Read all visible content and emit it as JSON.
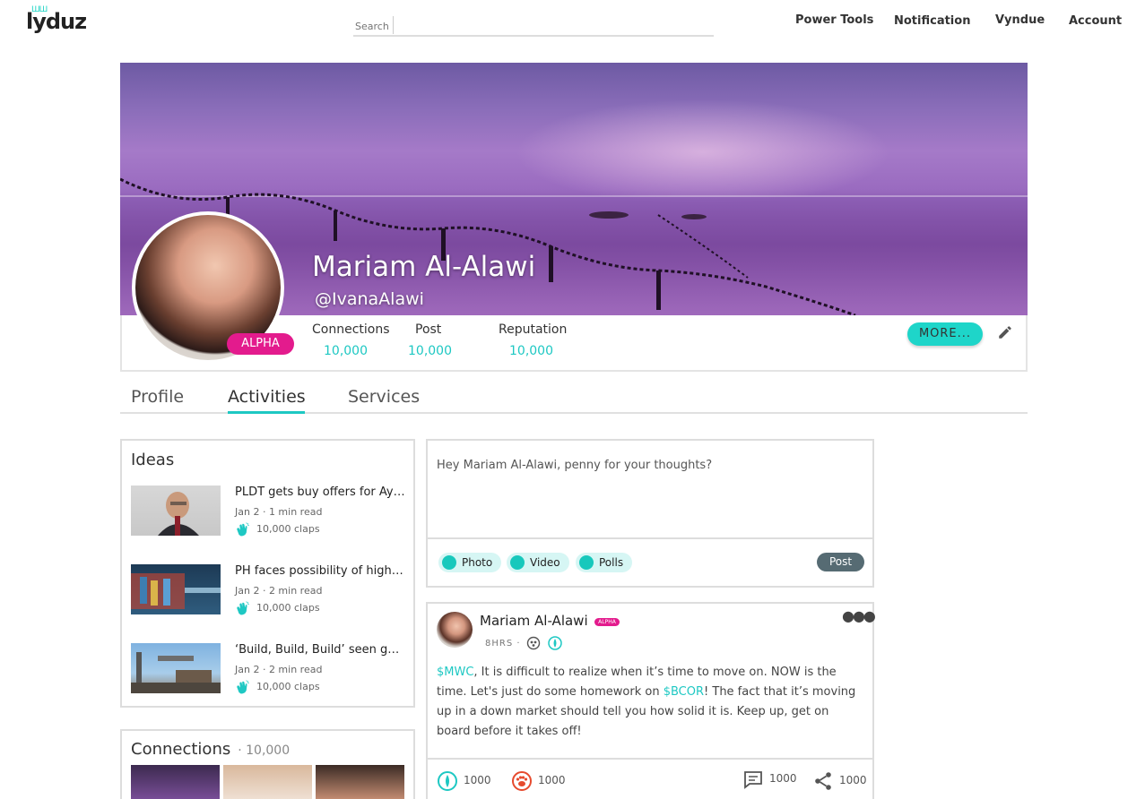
{
  "brand": {
    "logo_text": "lyduz",
    "logo_crown": "ШШ"
  },
  "search": {
    "placeholder": "Search"
  },
  "nav": {
    "items": [
      "Power Tools",
      "Notification",
      "Vyndue",
      "Account"
    ]
  },
  "profile": {
    "name": "Mariam Al-Alawi",
    "handle": "@IvanaAlawi",
    "badge": "ALPHA",
    "stats": [
      {
        "label": "Connections",
        "value": "10,000"
      },
      {
        "label": "Post",
        "value": "10,000"
      },
      {
        "label": "Reputation",
        "value": "10,000"
      }
    ],
    "more_label": "MORE..."
  },
  "tabs": [
    "Profile",
    "Activities",
    "Services"
  ],
  "active_tab": "Activities",
  "ideas": {
    "title": "Ideas",
    "items": [
      {
        "title": "PLDT gets buy offers for Ayala...",
        "meta": "Jan 2 · 1 min read",
        "claps": "10,000 claps"
      },
      {
        "title": "PH faces possibility of high inflation...",
        "meta": "Jan 2 · 2 min read",
        "claps": "10,000 claps"
      },
      {
        "title": "‘Build, Build, Build’ seen generating...",
        "meta": "Jan 2 · 2 min read",
        "claps": "10,000 claps"
      }
    ]
  },
  "composer": {
    "placeholder": "Hey Mariam Al-Alawi, penny for your thoughts?",
    "photo": "Photo",
    "video": "Video",
    "polls": "Polls",
    "post": "Post"
  },
  "post": {
    "author": "Mariam Al-Alawi",
    "badge": "ALPHA",
    "time": "8HRS ·",
    "ticker1": "$MWC",
    "text1": ", It is difficult to realize when it’s time to move on. NOW is the time.  Let's just do some homework on ",
    "ticker2": "$BCOR",
    "text2": "! The fact that it’s moving up in a down market should tell you how solid it is. Keep up, get on board before it takes off!",
    "bull_count": "1000",
    "bear_count": "1000",
    "comment_count": "1000",
    "share_count": "1000"
  },
  "connections": {
    "title": "Connections",
    "count": "· 10,000"
  },
  "colors": {
    "accent": "#1ec8c3",
    "badge": "#e31b8d",
    "post_button": "#566b73"
  }
}
